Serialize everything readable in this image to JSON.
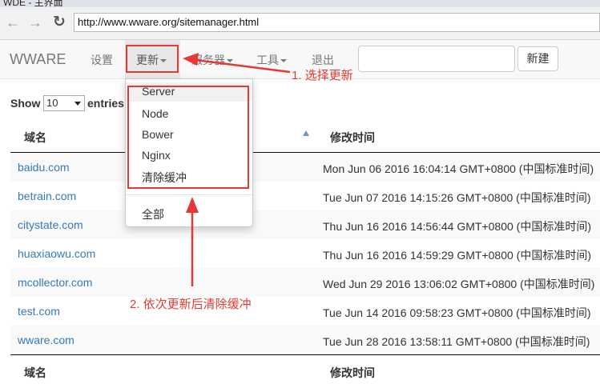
{
  "window": {
    "title": "WDE - 主界面"
  },
  "browser": {
    "url": "http://www.wware.org/sitemanager.html",
    "back_icon": "arrow-left-icon",
    "forward_icon": "arrow-right-icon",
    "reload_icon": "reload-icon"
  },
  "navbar": {
    "brand": "WWARE",
    "items": [
      {
        "label": "设置"
      },
      {
        "label": "更新"
      },
      {
        "label": "服务器"
      },
      {
        "label": "工具"
      },
      {
        "label": "退出"
      }
    ],
    "search_value": "",
    "new_button": "新建"
  },
  "dropdown": {
    "items": [
      "Server",
      "Node",
      "Bower",
      "Nginx",
      "清除缓冲"
    ],
    "all_label": "全部"
  },
  "table": {
    "show_label": "Show",
    "entries_value": "10",
    "entries_label": "entries",
    "headers": [
      "域名",
      "修改时间"
    ],
    "rows": [
      {
        "domain": "baidu.com",
        "time": "Mon Jun 06 2016 16:04:14 GMT+0800 (中国标准时间)"
      },
      {
        "domain": "betrain.com",
        "time": "Tue Jun 07 2016 14:15:26 GMT+0800 (中国标准时间)"
      },
      {
        "domain": "citystate.com",
        "time": "Thu Jun 16 2016 14:56:44 GMT+0800 (中国标准时间)"
      },
      {
        "domain": "huaxiaowu.com",
        "time": "Thu Jun 16 2016 14:59:29 GMT+0800 (中国标准时间)"
      },
      {
        "domain": "mcollector.com",
        "time": "Wed Jun 29 2016 13:06:02 GMT+0800 (中国标准时间)"
      },
      {
        "domain": "test.com",
        "time": "Tue Jun 14 2016 09:58:23 GMT+0800 (中国标准时间)"
      },
      {
        "domain": "wware.com",
        "time": "Tue Jun 28 2016 13:58:11 GMT+0800 (中国标准时间)"
      }
    ]
  },
  "annotations": {
    "step1": "1. 选择更新",
    "step2": "2. 依次更新后清除缓冲"
  },
  "colors": {
    "annotation": "#e53935",
    "link": "#337ab7",
    "sort_arrow": "#7a8fd0"
  }
}
